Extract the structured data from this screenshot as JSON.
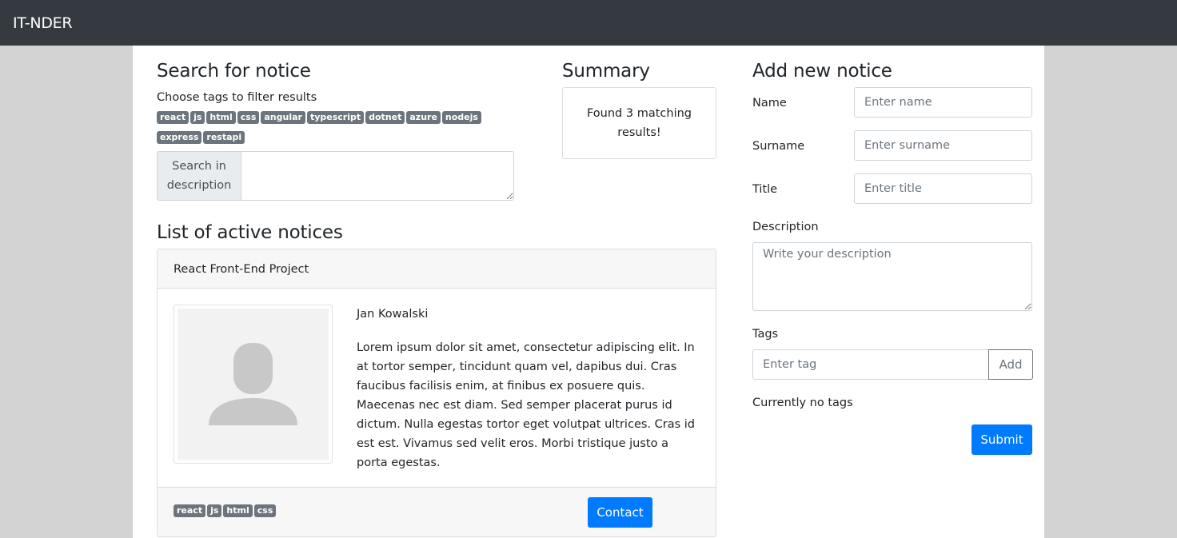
{
  "navbar": {
    "brand": "IT-NDER"
  },
  "search": {
    "heading": "Search for notice",
    "help": "Choose tags to filter results",
    "tags": [
      "react",
      "js",
      "html",
      "css",
      "angular",
      "typescript",
      "dotnet",
      "azure",
      "nodejs",
      "express",
      "restapi"
    ],
    "addon_label": "Search in description",
    "value": ""
  },
  "summary": {
    "heading": "Summary",
    "text": "Found 3 matching results!"
  },
  "notices": {
    "heading": "List of active notices",
    "items": [
      {
        "title": "React Front-End Project",
        "author": "Jan Kowalski",
        "description": "Lorem ipsum dolor sit amet, consectetur adipiscing elit. In at tortor semper, tincidunt quam vel, dapibus dui. Cras faucibus facilisis enim, at finibus ex posuere quis. Maecenas nec est diam. Sed semper placerat purus id dictum. Nulla egestas tortor eget volutpat ultrices. Cras id est est. Vivamus sed velit eros. Morbi tristique justo a porta egestas.",
        "tags": [
          "react",
          "js",
          "html",
          "css"
        ],
        "contact_label": "Contact"
      }
    ]
  },
  "add_form": {
    "heading": "Add new notice",
    "name_label": "Name",
    "name_placeholder": "Enter name",
    "surname_label": "Surname",
    "surname_placeholder": "Enter surname",
    "title_label": "Title",
    "title_placeholder": "Enter title",
    "description_label": "Description",
    "description_placeholder": "Write your description",
    "tags_label": "Tags",
    "tag_placeholder": "Enter tag",
    "add_label": "Add",
    "no_tags_text": "Currently no tags",
    "submit_label": "Submit"
  },
  "colors": {
    "navbar": "#343a40",
    "primary": "#007bff",
    "tag_badge": "#6c757d",
    "page_background": "#d3d3d3"
  }
}
